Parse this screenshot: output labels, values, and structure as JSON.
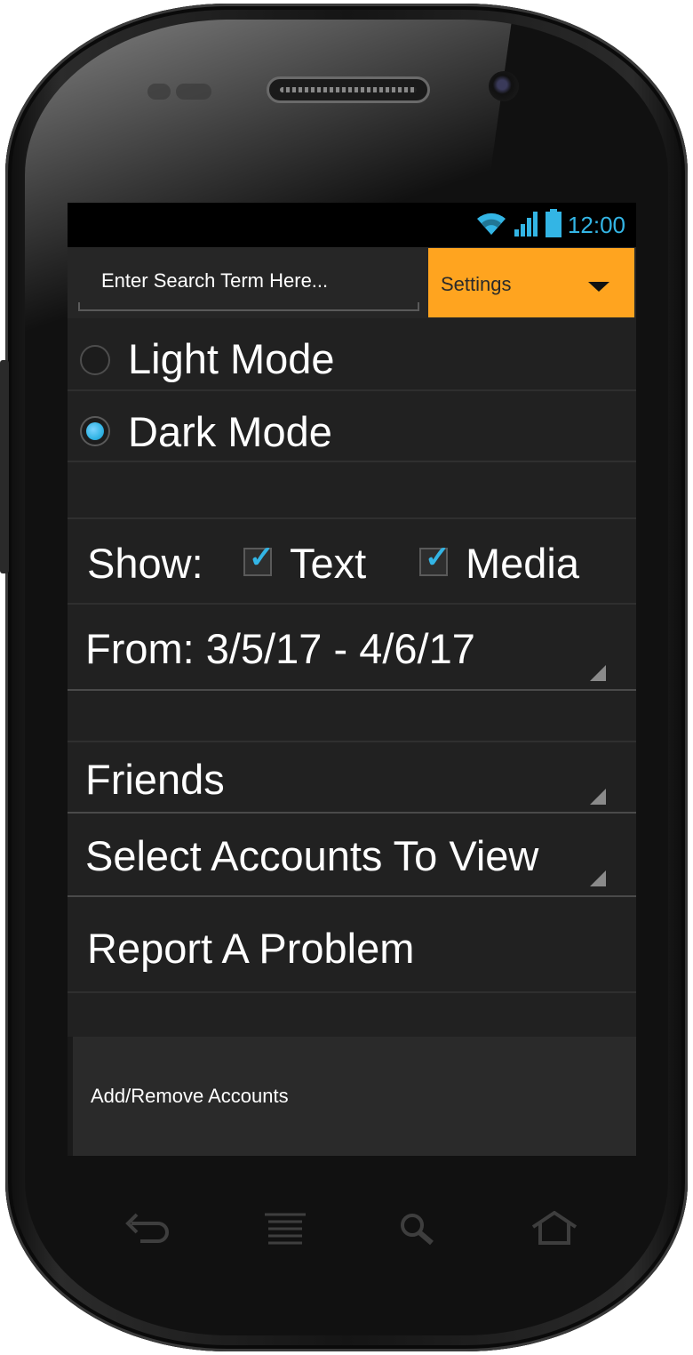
{
  "status_bar": {
    "time": "12:00",
    "icons": [
      "wifi-icon",
      "signal-icon",
      "battery-icon"
    ],
    "accent_color": "#33b5e5"
  },
  "action_bar": {
    "search_placeholder": "Enter Search Term Here...",
    "settings_label": "Settings",
    "settings_color": "#ffa41f"
  },
  "theme_options": [
    {
      "label": "Light Mode",
      "selected": false
    },
    {
      "label": "Dark Mode",
      "selected": true
    }
  ],
  "show_filter": {
    "label": "Show:",
    "options": [
      {
        "label": "Text",
        "checked": true
      },
      {
        "label": "Media",
        "checked": true
      }
    ]
  },
  "date_range": {
    "label": "From: 3/5/17 - 4/6/17"
  },
  "audience_spinner": {
    "label": "Friends"
  },
  "accounts_spinner": {
    "label": "Select Accounts To View"
  },
  "report_problem": {
    "label": "Report A Problem"
  },
  "bottom_bar": {
    "label": "Add/Remove Accounts"
  },
  "nav_keys": [
    "back-icon",
    "menu-icon",
    "search-icon",
    "home-icon"
  ]
}
